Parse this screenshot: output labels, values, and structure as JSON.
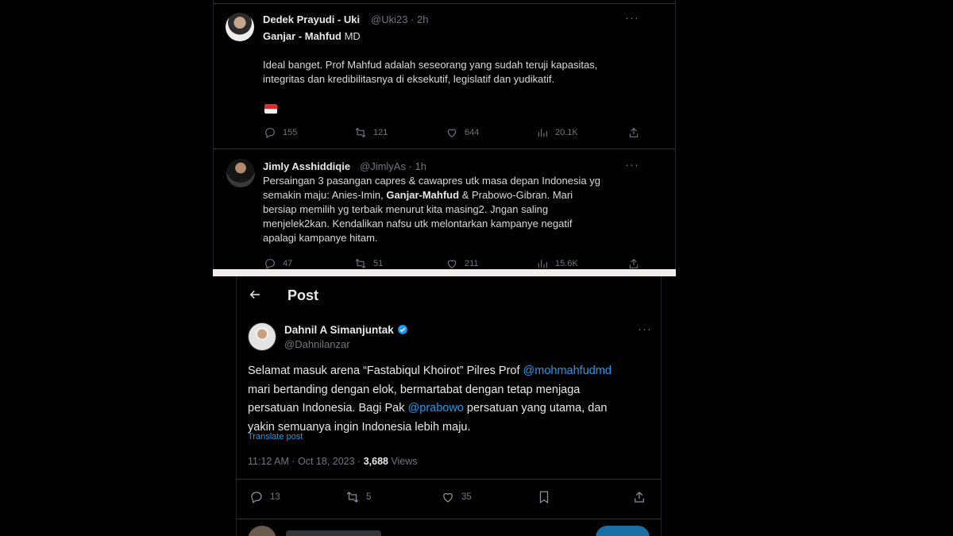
{
  "top": {
    "tweet1": {
      "name": "Dedek Prayudi - Uki",
      "handle": "@Uki23",
      "time": "2h",
      "line_bold": "Ganjar - Mahfud",
      "line_rest": " MD",
      "body_1": "Ideal banget. Prof Mahfud adalah seseorang yang sudah teruji kapasitas,",
      "body_2": "integritas dan kredibilitasnya di eksekutif, legislatif dan yudikatif.",
      "more": "···",
      "replies": "155",
      "reposts": "121",
      "likes": "644",
      "views": "20.1K"
    },
    "tweet2": {
      "name": "Jimly Asshiddiqie",
      "handle": "@JimlyAs",
      "time": "1h",
      "more": "···",
      "body_1": "Persaingan 3 pasangan capres & cawapres utk masa depan Indonesia yg",
      "body_2a": "semakin maju: Anies-Imin, ",
      "body_2b": "Ganjar-Mahfud",
      "body_2c": " & Prabowo-Gibran. Mari",
      "body_3": "bersiap memilih yg terbaik menurut kita masing2. Jngan saling",
      "body_4": "menjelek2kan. Kendalikan nafsu utk melontarkan kampanye negatif",
      "body_5": "apalagi kampanye hitam.",
      "replies": "47",
      "reposts": "51",
      "likes": "211",
      "views": "15.6K"
    }
  },
  "post": {
    "title": "Post",
    "name": "Dahnil A Simanjuntak",
    "handle": "@Dahnilanzar",
    "more": "···",
    "text_1": "Selamat masuk arena “Fastabiqul Khoirot” Pilres Prof ",
    "mention_1": "@mohmahfudmd",
    "text_2": "mari bertanding dengan elok, bermartabat dengan tetap menjaga",
    "text_3a": "persatuan Indonesia. Bagi Pak ",
    "mention_2": "@prabowo",
    "text_3b": " persatuan yang utama, dan",
    "text_4": "yakin semuanya ingin Indonesia lebih maju.",
    "translate": "Translate post",
    "time": "11:12 AM · Oct 18, 2023 · ",
    "views_count": "3,688",
    "views_label": " Views",
    "replies": "13",
    "reposts": "5",
    "likes": "35"
  },
  "colors": {
    "accent": "#1d9bf0",
    "text": "#e7e9ea",
    "muted": "#71767b",
    "background": "#000000"
  }
}
